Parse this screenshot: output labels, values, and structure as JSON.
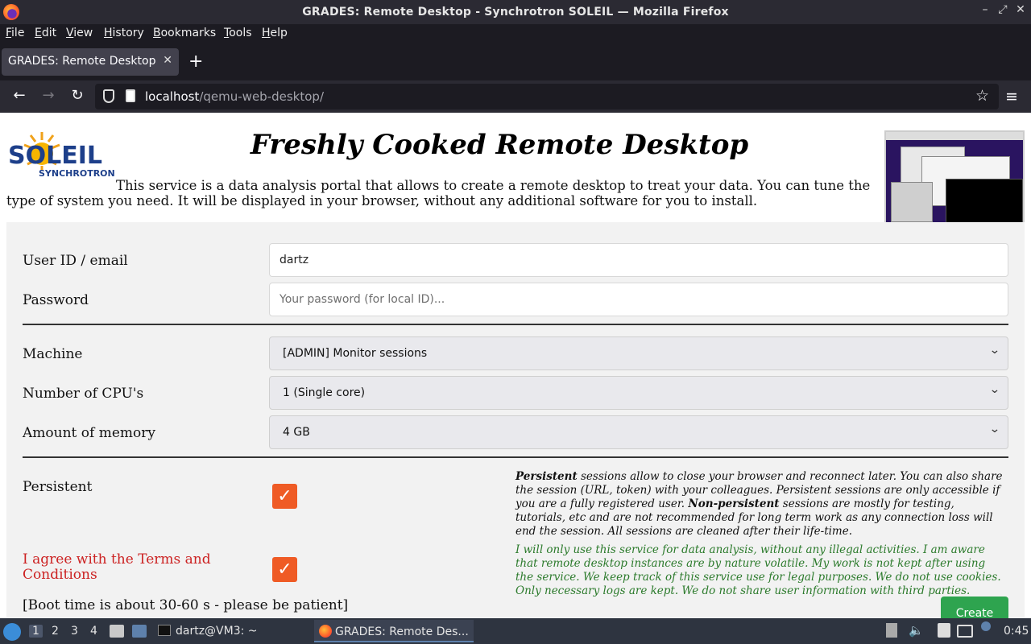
{
  "window": {
    "title": "GRADES: Remote Desktop - Synchrotron SOLEIL — Mozilla Firefox",
    "minimize": "–",
    "maximize": "⤢",
    "close": "✕"
  },
  "menu": [
    "File",
    "Edit",
    "View",
    "History",
    "Bookmarks",
    "Tools",
    "Help"
  ],
  "tab": {
    "label": "GRADES: Remote Desktop - Synchrotron SOLEIL",
    "close": "✕",
    "new": "+"
  },
  "nav": {
    "back": "←",
    "forward": "→",
    "reload": "↻",
    "url_host": "localhost",
    "url_path": "/qemu-web-desktop/",
    "bookmark_star": "☆",
    "menu": "≡"
  },
  "page": {
    "logo_text": "SOLEIL",
    "logo_subtext": "SYNCHROTRON",
    "heading": "Freshly Cooked Remote Desktop",
    "intro": "This service is a data analysis portal that allows to create a remote desktop to treat your data. You can tune the type of system you need. It will be displayed in your browser, without any additional software for you to install.",
    "form": {
      "user_label": "User ID / email",
      "user_value": "dartz",
      "password_label": "Password",
      "password_placeholder": "Your password (for local ID)...",
      "machine_label": "Machine",
      "machine_value": "[ADMIN] Monitor sessions",
      "cpu_label": "Number of CPU's",
      "cpu_value": "1 (Single core)",
      "memory_label": "Amount of memory",
      "memory_value": "4 GB",
      "persistent_label": "Persistent",
      "persistent_checked": true,
      "terms_label_1": "I agree with the Terms and",
      "terms_label_2": "Conditions",
      "terms_checked": true,
      "boot_note": "[Boot time is about 30-60 s - please be patient]",
      "create_label": "Create",
      "chevron": "⌄",
      "checkmark": "✓"
    },
    "persistent_note": {
      "b1": "Persistent",
      "t1": " sessions allow to close your browser and reconnect later. You can also share the session (URL, token) with your colleagues. Persistent sessions are only accessible if you are a fully registered user. ",
      "b2": "Non-persistent",
      "t2": " sessions are mostly for testing, tutorials, etc and are not recommended for long term work as any connection loss will end the session. All sessions are cleaned after their life-time."
    },
    "legal_note": "I will only use this service for data analysis, without any illegal activities. I am aware that remote desktop instances are by nature volatile. My work is not kept after using the service. We keep track of this service use for legal purposes. We do not use cookies. Only necessary logs are kept. We do not share user information with third parties."
  },
  "taskbar": {
    "workspaces": [
      "1",
      "2",
      "3",
      "4"
    ],
    "terminal_task": "dartz@VM3: ~",
    "firefox_task": "GRADES: Remote Des...",
    "clock": "0:45"
  },
  "colors": {
    "accent_check": "#ef5b25",
    "create_button": "#2ea44f",
    "terms_red": "#cc2222",
    "legal_green": "#2b7a2b"
  }
}
